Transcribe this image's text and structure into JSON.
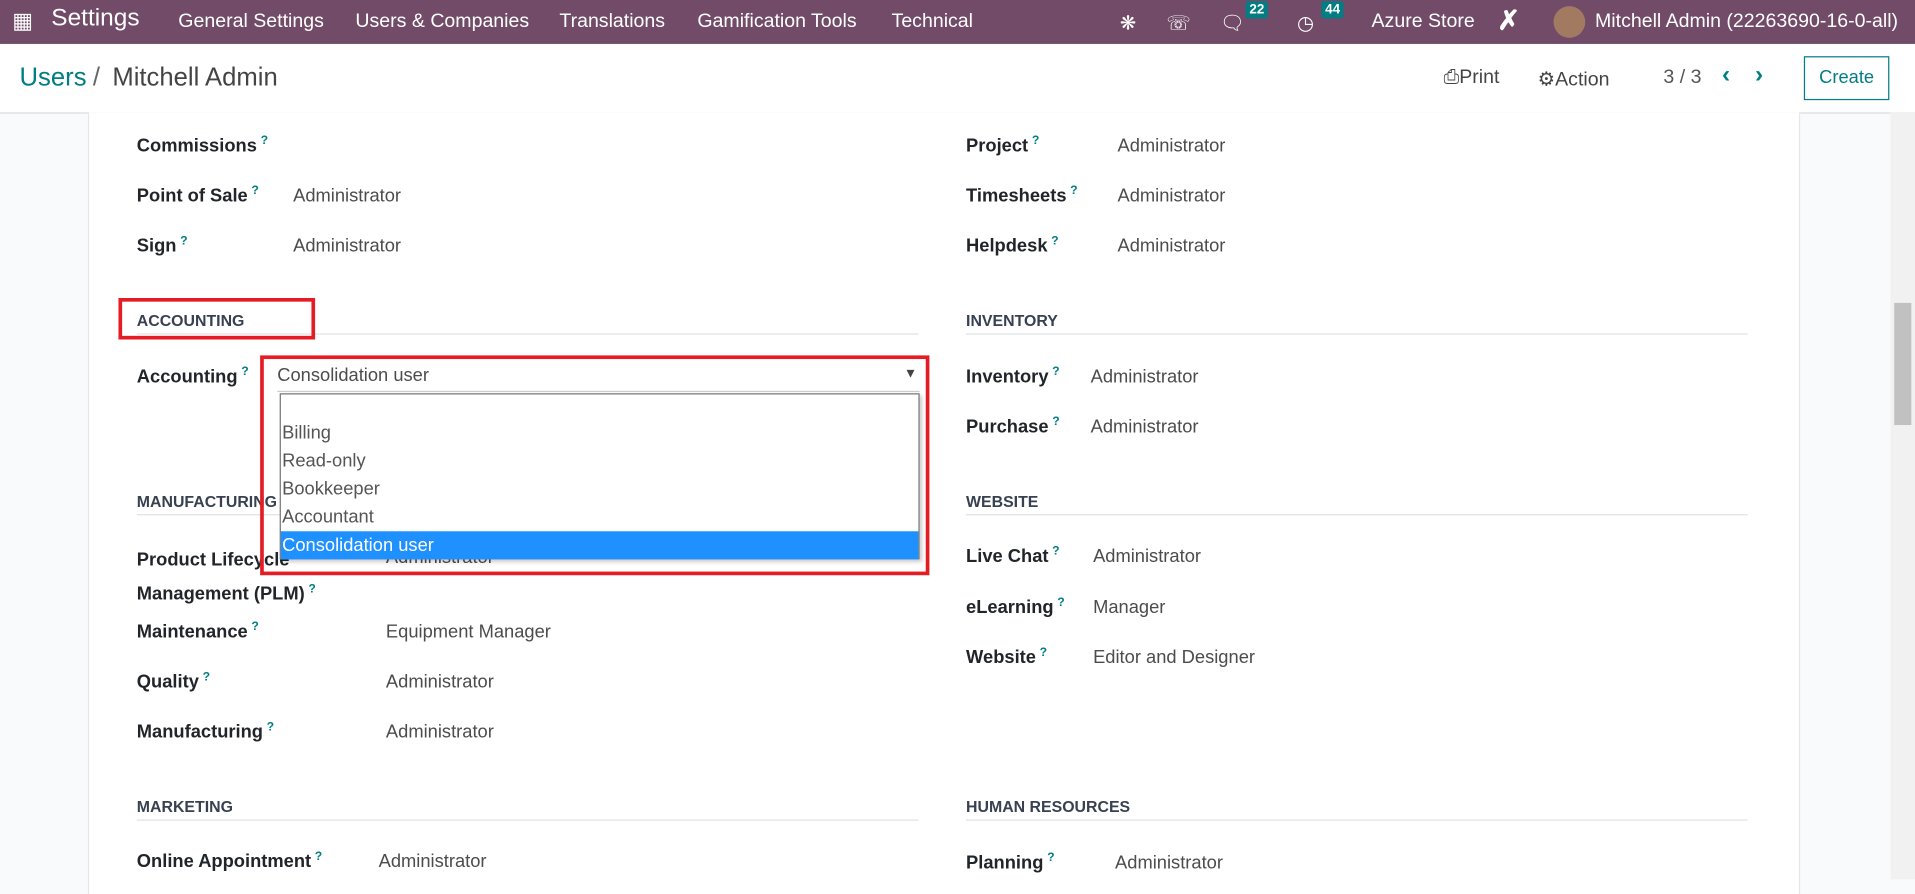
{
  "navbar": {
    "app": "Settings",
    "menus": [
      "General Settings",
      "Users & Companies",
      "Translations",
      "Gamification Tools",
      "Technical"
    ],
    "messages_count": "22",
    "activities_count": "44",
    "company": "Azure Store",
    "user": "Mitchell Admin (22263690-16-0-all)",
    "color": "#714b67"
  },
  "control": {
    "breadcrumb_parent": "Users",
    "breadcrumb_sep": "/",
    "breadcrumb_current": "Mitchell Admin",
    "print": "Print",
    "action": "Action",
    "pager": "3 / 3",
    "create": "Create"
  },
  "left": {
    "top": [
      {
        "label": "Commissions",
        "value": ""
      },
      {
        "label": "Point of Sale",
        "value": "Administrator"
      },
      {
        "label": "Sign",
        "value": "Administrator"
      }
    ],
    "accounting": {
      "header": "ACCOUNTING",
      "label": "Accounting",
      "value": "Consolidation user",
      "options": [
        "",
        "Billing",
        "Read-only",
        "Bookkeeper",
        "Accountant",
        "Consolidation user"
      ],
      "selected": "Consolidation user"
    },
    "manufacturing": {
      "header": "MANUFACTURING",
      "rows": [
        {
          "label": "Product Lifecycle Management (PLM)",
          "label1": "Product Lifecycle",
          "label2": "Management (PLM)",
          "value": "Administrator"
        },
        {
          "label": "Maintenance",
          "value": "Equipment Manager"
        },
        {
          "label": "Quality",
          "value": "Administrator"
        },
        {
          "label": "Manufacturing",
          "value": "Administrator"
        }
      ]
    },
    "marketing": {
      "header": "MARKETING",
      "rows": [
        {
          "label": "Online Appointment",
          "value": "Administrator"
        }
      ]
    }
  },
  "right": {
    "top": [
      {
        "label": "Project",
        "value": "Administrator"
      },
      {
        "label": "Timesheets",
        "value": "Administrator"
      },
      {
        "label": "Helpdesk",
        "value": "Administrator"
      }
    ],
    "inventory": {
      "header": "INVENTORY",
      "rows": [
        {
          "label": "Inventory",
          "value": "Administrator"
        },
        {
          "label": "Purchase",
          "value": "Administrator"
        }
      ]
    },
    "website": {
      "header": "WEBSITE",
      "rows": [
        {
          "label": "Live Chat",
          "value": "Administrator"
        },
        {
          "label": "eLearning",
          "value": "Manager"
        },
        {
          "label": "Website",
          "value": "Editor and Designer"
        }
      ]
    },
    "hr": {
      "header": "HUMAN RESOURCES",
      "rows": [
        {
          "label": "Planning",
          "value": "Administrator"
        }
      ]
    }
  },
  "help_mark": "?"
}
